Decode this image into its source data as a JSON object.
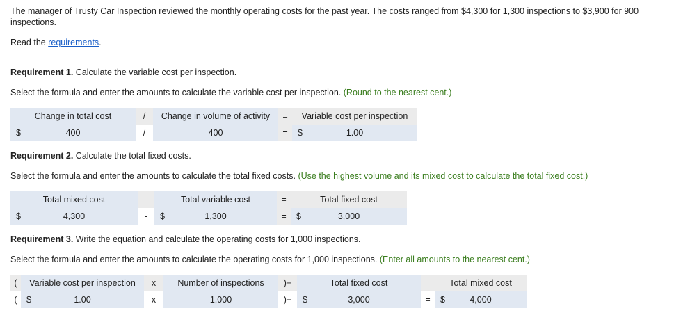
{
  "intro": "The manager of Trusty Car Inspection reviewed the monthly operating costs for the past year. The costs ranged from $4,300 for 1,300 inspections to $3,900 for 900",
  "intro2": "inspections.",
  "read_prefix": "Read the ",
  "read_link": "requirements",
  "read_suffix": ".",
  "req1": {
    "title": "Requirement 1.",
    "text": " Calculate the variable cost per inspection.",
    "instr": "Select the formula and enter the amounts to calculate the variable cost per inspection.",
    "hint": "(Round to the nearest cent.)",
    "h": [
      "Change in total cost",
      "/",
      "Change in volume of activity",
      "=",
      "Variable cost per inspection"
    ],
    "v": [
      "400",
      "/",
      "400",
      "=",
      "1.00"
    ],
    "cur": "$"
  },
  "req2": {
    "title": "Requirement 2.",
    "text": " Calculate the total fixed costs.",
    "instr": "Select the formula and enter the amounts to calculate the total fixed costs.",
    "hint": "(Use the highest volume and its mixed cost to calculate the total fixed cost.)",
    "h": [
      "Total mixed cost",
      "-",
      "Total variable cost",
      "=",
      "Total fixed cost"
    ],
    "v": [
      "4,300",
      "-",
      "1,300",
      "=",
      "3,000"
    ],
    "cur": "$"
  },
  "req3": {
    "title": "Requirement 3.",
    "text": " Write the equation and calculate the operating costs for 1,000 inspections.",
    "instr": "Select the formula and enter the amounts to calculate the operating costs for 1,000 inspections.",
    "hint": "(Enter all amounts to the nearest cent.)",
    "h": [
      "(",
      "Variable cost per inspection",
      "x",
      "Number of inspections",
      ")+",
      "Total fixed cost",
      "=",
      "Total mixed cost"
    ],
    "v": [
      "(",
      "1.00",
      "x",
      "1,000",
      ")+",
      "3,000",
      "=",
      "4,000"
    ],
    "cur": "$"
  }
}
